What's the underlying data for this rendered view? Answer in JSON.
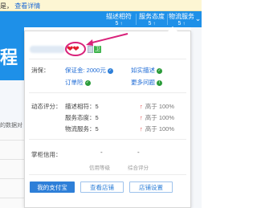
{
  "notice": {
    "text": "是",
    "link": "查看详情"
  },
  "stats": [
    {
      "label": "描述相符",
      "value": "5",
      "arrow": "↑"
    },
    {
      "label": "服务态度",
      "value": "5",
      "arrow": "↑"
    },
    {
      "label": "物流服务",
      "value": "5",
      "arrow": "↑"
    }
  ],
  "stats_dropdown": "⌄",
  "background": {
    "title": "程",
    "side_label": "的数据对"
  },
  "popup": {
    "hearts": "❤❤",
    "green_badge": "卫",
    "consumer_protection": {
      "label": "消保：",
      "items": [
        {
          "text": "保证金: 2000元",
          "icon": "check-circle-icon",
          "blue": true
        },
        {
          "text": "如实描述",
          "icon": "check-circle-icon",
          "blue": false
        },
        {
          "text": "订单险",
          "icon": "check-circle-icon",
          "blue": false
        },
        {
          "text": "更多问题",
          "icon": "info-circle-icon",
          "blue": false
        }
      ]
    },
    "dynamic_score": {
      "label": "动态评分：",
      "items": [
        {
          "name": "描述相符：5",
          "compare": "高于 100%"
        },
        {
          "name": "服务态度：5",
          "compare": "高于 100%"
        },
        {
          "name": "物流服务：5",
          "compare": "高于 100%"
        }
      ]
    },
    "seller_credit": {
      "label": "掌柜信用：",
      "values": [
        {
          "value": "-",
          "sub": "信用等级"
        },
        {
          "value": "-",
          "sub": "综合评分"
        }
      ]
    },
    "buttons": [
      {
        "label": "我的支付宝",
        "style": "primary"
      },
      {
        "label": "查看店铺",
        "style": "secondary"
      },
      {
        "label": "店铺设置",
        "style": "secondary"
      }
    ]
  }
}
